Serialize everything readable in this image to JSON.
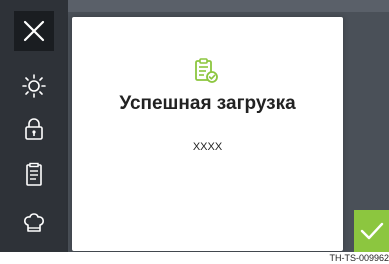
{
  "dialog": {
    "title": "Успешная загрузка",
    "value": "XXXX",
    "icon": "clipboard-check-icon"
  },
  "sidebar": {
    "items": [
      {
        "icon": "close-icon"
      },
      {
        "icon": "brightness-icon"
      },
      {
        "icon": "lock-icon"
      },
      {
        "icon": "document-icon"
      },
      {
        "icon": "chef-hat-icon"
      }
    ]
  },
  "confirm": {
    "icon": "checkmark-icon"
  },
  "caption": "TH-TS-009962",
  "colors": {
    "accent_green": "#8cc63f",
    "sidebar_bg": "#2e3238",
    "screen_bg": "#4a5058",
    "icon_white": "#ffffff"
  }
}
